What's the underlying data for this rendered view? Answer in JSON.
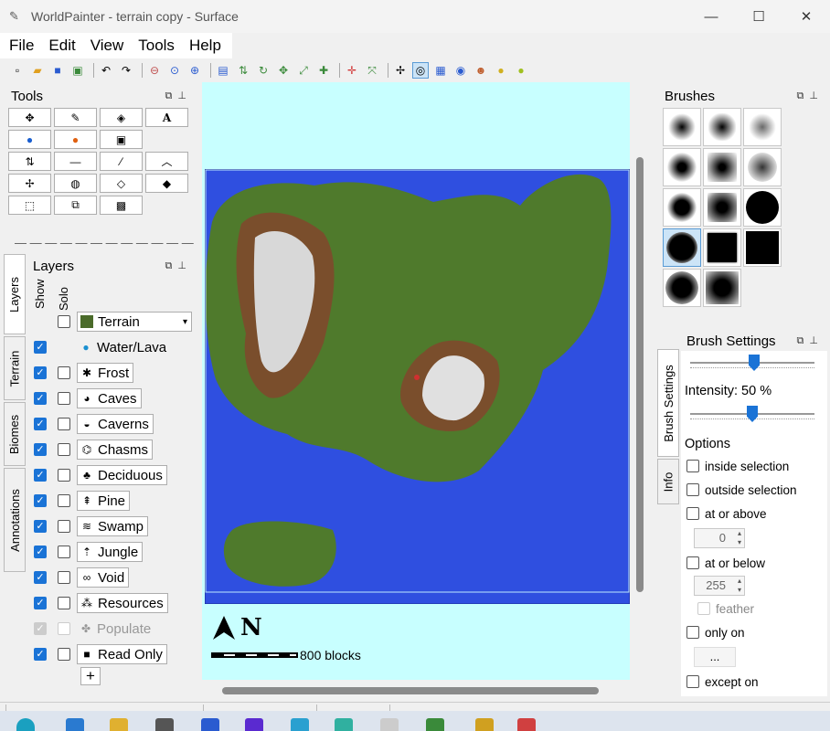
{
  "window": {
    "title": "WorldPainter - terrain copy - Surface"
  },
  "menu": {
    "items": [
      "File",
      "Edit",
      "View",
      "Tools",
      "Help"
    ]
  },
  "tools_panel": {
    "title": "Tools"
  },
  "layers_panel": {
    "title": "Layers",
    "col_show": "Show",
    "col_solo": "Solo",
    "terrain_combo": "Terrain",
    "rows": [
      {
        "label": "Water/Lava",
        "icon": "water-drop-icon"
      },
      {
        "label": "Frost",
        "icon": "snowflake-icon"
      },
      {
        "label": "Caves",
        "icon": "caves-icon"
      },
      {
        "label": "Caverns",
        "icon": "caverns-icon"
      },
      {
        "label": "Chasms",
        "icon": "chasms-icon"
      },
      {
        "label": "Deciduous",
        "icon": "deciduous-tree-icon"
      },
      {
        "label": "Pine",
        "icon": "pine-tree-icon"
      },
      {
        "label": "Swamp",
        "icon": "swamp-icon"
      },
      {
        "label": "Jungle",
        "icon": "jungle-icon"
      },
      {
        "label": "Void",
        "icon": "void-icon"
      },
      {
        "label": "Resources",
        "icon": "resources-icon"
      },
      {
        "label": "Populate",
        "icon": "populate-icon"
      },
      {
        "label": "Read Only",
        "icon": "lock-icon"
      }
    ],
    "add_label": "+"
  },
  "side_tabs": [
    "Layers",
    "Terrain",
    "Biomes",
    "Annotations"
  ],
  "viewport": {
    "scale_label": "800 blocks",
    "north_label": "N"
  },
  "brushes_panel": {
    "title": "Brushes"
  },
  "brush_settings": {
    "tab_label": "Brush Settings",
    "info_tab": "Info",
    "title": "Brush Settings",
    "intensity_label": "Intensity: 50 %",
    "intensity": 0.5,
    "options_title": "Options",
    "inside_selection": "inside selection",
    "outside_selection": "outside selection",
    "at_or_above": "at or above",
    "at_or_above_value": "0",
    "at_or_below": "at or below",
    "at_or_below_value": "255",
    "feather": "feather",
    "only_on": "only on",
    "only_on_button": "...",
    "except_on": "except on"
  }
}
